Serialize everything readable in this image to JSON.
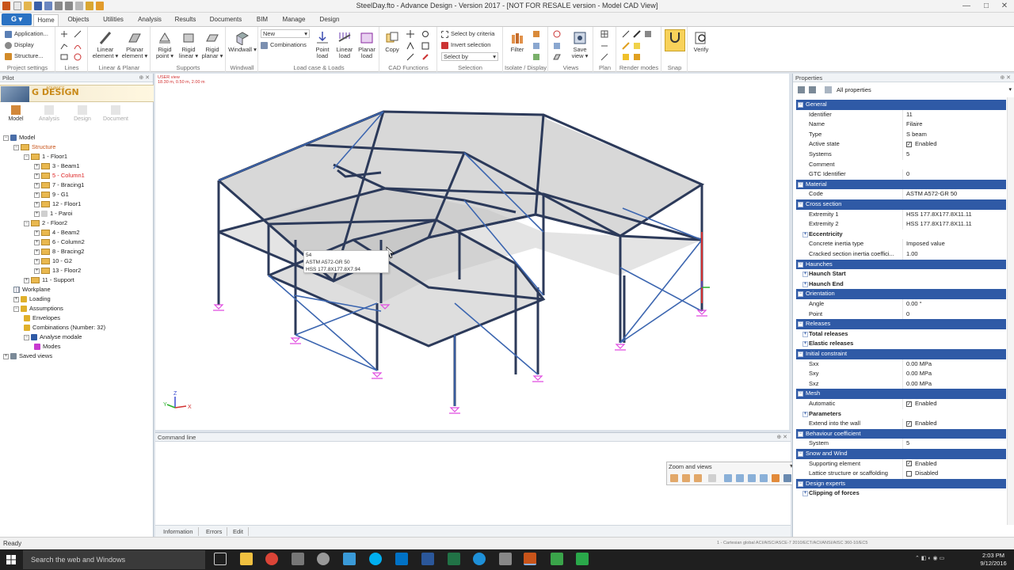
{
  "window": {
    "title": "SteelDay.fto - Advance Design - Version 2017 - [NOT FOR RESALE version - Model CAD View]",
    "minimize": "—",
    "maximize": "□",
    "close": "✕"
  },
  "ribbon": {
    "app_button": "G ▾",
    "tabs": [
      "Home",
      "Objects",
      "Utilities",
      "Analysis",
      "Results",
      "Documents",
      "BIM",
      "Manage",
      "Design"
    ],
    "active_tab": "Home",
    "groups": {
      "project_settings": {
        "label": "Project settings",
        "items": [
          "Application...",
          "Display",
          "Structure..."
        ]
      },
      "lines": {
        "label": "Lines"
      },
      "linear_planar": {
        "label": "Linear & Planar",
        "linear_element": "Linear element ▾",
        "planar_element": "Planar element ▾"
      },
      "supports": {
        "label": "Supports",
        "rigid_point": "Rigid point ▾",
        "rigid_linear": "Rigid linear ▾",
        "rigid_planar": "Rigid planar ▾"
      },
      "windwall": {
        "label": "Windwall",
        "windwall": "Windwall ▾"
      },
      "loads": {
        "label": "Load case & Loads",
        "combo_value": "New",
        "combinations": "Combinations",
        "point_load": "Point load",
        "linear_load": "Linear load",
        "planar_load": "Planar load"
      },
      "cad": {
        "label": "CAD Functions",
        "copy": "Copy"
      },
      "selection": {
        "label": "Selection",
        "select_by_criteria": "Select by criteria",
        "invert_selection": "Invert selection",
        "select_by": "Select by"
      },
      "isolate": {
        "label": "Isolate / Display",
        "filter": "Filter"
      },
      "views": {
        "label": "Views",
        "save_view": "Save view ▾"
      },
      "plan": {
        "label": "Plan"
      },
      "render": {
        "label": "Render modes"
      },
      "snap": {
        "label": "Snap"
      },
      "verify": {
        "label": "",
        "verify": "Verify"
      }
    }
  },
  "pilot": {
    "title": "Pilot",
    "logo_small": "ADVANCE",
    "logo_text": "DESIGN",
    "tabs": [
      "Model",
      "Analysis",
      "Design",
      "Document"
    ],
    "tree": [
      {
        "label": "Model",
        "indent": 0,
        "exp": "−",
        "icon": "model",
        "color": ""
      },
      {
        "label": "Structure",
        "indent": 1,
        "exp": "−",
        "icon": "folder",
        "color": "orange"
      },
      {
        "label": "1 - Floor1",
        "indent": 2,
        "exp": "−",
        "icon": "folder",
        "color": ""
      },
      {
        "label": "3 - Beam1",
        "indent": 3,
        "exp": "+",
        "icon": "folder",
        "color": ""
      },
      {
        "label": "5 - Column1",
        "indent": 3,
        "exp": "+",
        "icon": "folder",
        "color": "red"
      },
      {
        "label": "7 - Bracing1",
        "indent": 3,
        "exp": "+",
        "icon": "folder",
        "color": ""
      },
      {
        "label": "9 - G1",
        "indent": 3,
        "exp": "+",
        "icon": "folder",
        "color": ""
      },
      {
        "label": "12 - Floor1",
        "indent": 3,
        "exp": "+",
        "icon": "folder",
        "color": ""
      },
      {
        "label": "1 - Paroi",
        "indent": 3,
        "exp": "+",
        "icon": "plate",
        "color": ""
      },
      {
        "label": "2 - Floor2",
        "indent": 2,
        "exp": "−",
        "icon": "folder",
        "color": ""
      },
      {
        "label": "4 - Beam2",
        "indent": 3,
        "exp": "+",
        "icon": "folder",
        "color": ""
      },
      {
        "label": "6 - Column2",
        "indent": 3,
        "exp": "+",
        "icon": "folder",
        "color": ""
      },
      {
        "label": "8 - Bracing2",
        "indent": 3,
        "exp": "+",
        "icon": "folder",
        "color": ""
      },
      {
        "label": "10 - G2",
        "indent": 3,
        "exp": "+",
        "icon": "folder",
        "color": ""
      },
      {
        "label": "13 - Floor2",
        "indent": 3,
        "exp": "+",
        "icon": "folder",
        "color": ""
      },
      {
        "label": "11 - Support",
        "indent": 2,
        "exp": "+",
        "icon": "folder",
        "color": ""
      },
      {
        "label": "Workplane",
        "indent": 1,
        "exp": "",
        "icon": "grid",
        "color": ""
      },
      {
        "label": "Loading",
        "indent": 1,
        "exp": "+",
        "icon": "load",
        "color": ""
      },
      {
        "label": "Assumptions",
        "indent": 1,
        "exp": "−",
        "icon": "load",
        "color": ""
      },
      {
        "label": "Envelopes",
        "indent": 2,
        "exp": "",
        "icon": "load",
        "color": ""
      },
      {
        "label": "Combinations (Number: 32)",
        "indent": 2,
        "exp": "",
        "icon": "load",
        "color": ""
      },
      {
        "label": "Analyse modale",
        "indent": 2,
        "exp": "−",
        "icon": "modal",
        "color": ""
      },
      {
        "label": "Modes",
        "indent": 3,
        "exp": "",
        "icon": "modes",
        "color": ""
      },
      {
        "label": "Saved views",
        "indent": 0,
        "exp": "+",
        "icon": "views",
        "color": ""
      }
    ]
  },
  "viewport": {
    "view_name": "USER view",
    "coords": "18.30 m, 0.50 m, 2.00 m",
    "tooltip": [
      "54",
      "ASTM A572-GR 50",
      "HSS 177.8X177.8X7.94"
    ]
  },
  "command_line": {
    "title": "Command line",
    "tabs": [
      "Information",
      "Errors",
      "Edit"
    ]
  },
  "zoom_views": {
    "title": "Zoom and views"
  },
  "properties": {
    "title": "Properties",
    "filter": "All properties",
    "rows": [
      {
        "kind": "section",
        "label": "General"
      },
      {
        "kind": "row",
        "key": "Identifier",
        "value": "11"
      },
      {
        "kind": "row",
        "key": "Name",
        "value": "Filaire"
      },
      {
        "kind": "row",
        "key": "Type",
        "value": "S beam"
      },
      {
        "kind": "check",
        "key": "Active state",
        "value": "Enabled",
        "checked": true
      },
      {
        "kind": "row",
        "key": "Systems",
        "value": "5"
      },
      {
        "kind": "row",
        "key": "Comment",
        "value": ""
      },
      {
        "kind": "row",
        "key": "GTC Identifier",
        "value": "0"
      },
      {
        "kind": "section",
        "label": "Material"
      },
      {
        "kind": "row",
        "key": "Code",
        "value": "ASTM A572-GR 50"
      },
      {
        "kind": "section",
        "label": "Cross section"
      },
      {
        "kind": "row",
        "key": "Extremity 1",
        "value": "HSS 177.8X177.8X11.11"
      },
      {
        "kind": "row",
        "key": "Extremity 2",
        "value": "HSS 177.8X177.8X11.11"
      },
      {
        "kind": "sub",
        "key": "Eccentricity",
        "value": ""
      },
      {
        "kind": "row",
        "key": "Concrete inertia type",
        "value": "Imposed value"
      },
      {
        "kind": "row",
        "key": "Cracked section inertia coeffici...",
        "value": "1.00"
      },
      {
        "kind": "section",
        "label": "Haunches"
      },
      {
        "kind": "sub",
        "key": "Haunch Start",
        "value": ""
      },
      {
        "kind": "sub",
        "key": "Haunch End",
        "value": ""
      },
      {
        "kind": "section",
        "label": "Orientation"
      },
      {
        "kind": "row",
        "key": "Angle",
        "value": "0.00 °"
      },
      {
        "kind": "row",
        "key": "Point",
        "value": "0"
      },
      {
        "kind": "section",
        "label": "Releases"
      },
      {
        "kind": "sub",
        "key": "Total releases",
        "value": ""
      },
      {
        "kind": "sub",
        "key": "Elastic releases",
        "value": ""
      },
      {
        "kind": "section",
        "label": "Initial constraint"
      },
      {
        "kind": "row",
        "key": "Sxx",
        "value": "0.00 MPa"
      },
      {
        "kind": "row",
        "key": "Sxy",
        "value": "0.00 MPa"
      },
      {
        "kind": "row",
        "key": "Sxz",
        "value": "0.00 MPa"
      },
      {
        "kind": "section",
        "label": "Mesh"
      },
      {
        "kind": "check",
        "key": "Automatic",
        "value": "Enabled",
        "checked": true
      },
      {
        "kind": "sub",
        "key": "Parameters",
        "value": ""
      },
      {
        "kind": "check",
        "key": "Extend into the wall",
        "value": "Enabled",
        "checked": true
      },
      {
        "kind": "section",
        "label": "Behaviour coefficient"
      },
      {
        "kind": "row",
        "key": "System",
        "value": "5"
      },
      {
        "kind": "section",
        "label": "Snow and Wind"
      },
      {
        "kind": "check",
        "key": "Supporting element",
        "value": "Enabled",
        "checked": true
      },
      {
        "kind": "check",
        "key": "Lattice structure or scaffolding",
        "value": "Disabled",
        "checked": false
      },
      {
        "kind": "section",
        "label": "Design experts"
      },
      {
        "kind": "sub",
        "key": "Clipping of forces",
        "value": ""
      }
    ]
  },
  "statusbar": {
    "ready": "Ready",
    "right": "1 - Cartesian global ACI/AISC/ASCE-7 2010/ECT/ACI/ANSI/AISC 360-10/EC5"
  },
  "taskbar": {
    "search": "Search the web and Windows",
    "time": "2:03 PM",
    "date": "9/12/2016"
  },
  "colors": {
    "accent": "#2a72c3",
    "section": "#2f5aa6",
    "frame": "#2c3a5a",
    "support": "#e04ce0"
  }
}
